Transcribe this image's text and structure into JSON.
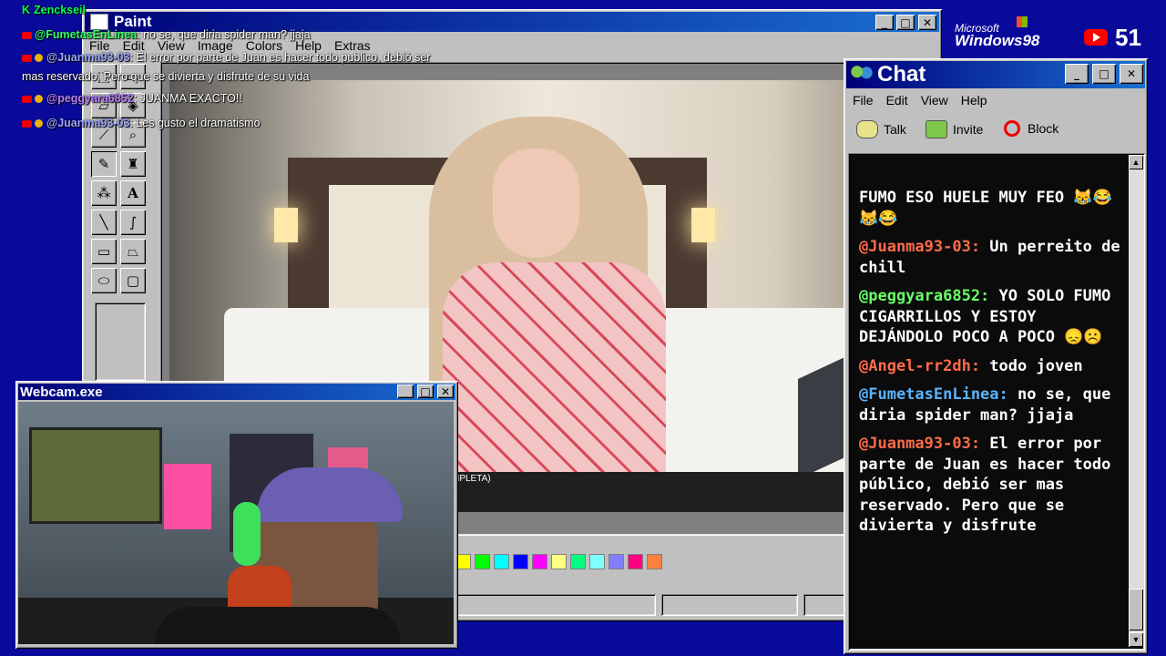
{
  "overlay_chat": [
    {
      "user": "Zenckseil",
      "text": "",
      "user_color": "#00ff55",
      "badge": "K"
    },
    {
      "user": "@FumetasEnLinea",
      "text": ": no se, que diria spider man? jjaja",
      "user_color": "#33ff66"
    },
    {
      "user": "@Juanma93-03",
      "text": ": El error por parte de Juan es hacer todo publico, debió ser",
      "user_color": "#9aa6ff"
    },
    {
      "user": "",
      "text": "mas reservado. Pero que se divierta y disfrute de su vida",
      "user_color": "#ffffff"
    },
    {
      "user": "@peggyara6852",
      "text": ": JUANMA EXACTO!!",
      "user_color": "#b57cff"
    },
    {
      "user": "@Juanma93-03",
      "text": ": Les gusto el dramatismo",
      "user_color": "#9aa6ff"
    }
  ],
  "branding": {
    "microsoft": "Microsoft",
    "windows": "Windows98",
    "viewer_count": "51"
  },
  "paint_window": {
    "title": "Paint",
    "menu": [
      "File",
      "Edit",
      "View",
      "Image",
      "Colors",
      "Help",
      "Extras"
    ],
    "video_caption": "MPLETA)",
    "palette": [
      "#ffff00",
      "#00ff00",
      "#00ffff",
      "#0000ff",
      "#ff00ff",
      "#ffff80",
      "#00ff80",
      "#80ffff",
      "#8080ff",
      "#ff0080",
      "#ff8040"
    ]
  },
  "webcam_window": {
    "title": "Webcam.exe"
  },
  "chat_window": {
    "title": "Chat",
    "menu": [
      "File",
      "Edit",
      "View",
      "Help"
    ],
    "toolbar": {
      "talk": "Talk",
      "invite": "Invite",
      "block": "Block"
    },
    "messages": [
      {
        "user": "",
        "text": "FUMO ESO HUELE MUY FEO 😹😂😹😂",
        "user_color": "#66ff66"
      },
      {
        "user": "@Juanma93-03:",
        "text": " Un perreito de chill",
        "user_color": "#ff6b4a"
      },
      {
        "user": "@peggyara6852:",
        "text": " YO SOLO FUMO CIGARRILLOS Y ESTOY DEJÁNDOLO POCO A POCO 😞☹️",
        "user_color": "#66ff66"
      },
      {
        "user": "@Angel-rr2dh:",
        "text": " todo joven",
        "user_color": "#ff6b4a"
      },
      {
        "user": "@FumetasEnLinea:",
        "text": " no se, que diria spider man? jjaja",
        "user_color": "#5ab4ff"
      },
      {
        "user": "@Juanma93-03:",
        "text": " El error por parte de Juan es hacer todo público, debió ser mas reservado. Pero que se divierta y disfrute",
        "user_color": "#ff6b4a"
      }
    ]
  }
}
